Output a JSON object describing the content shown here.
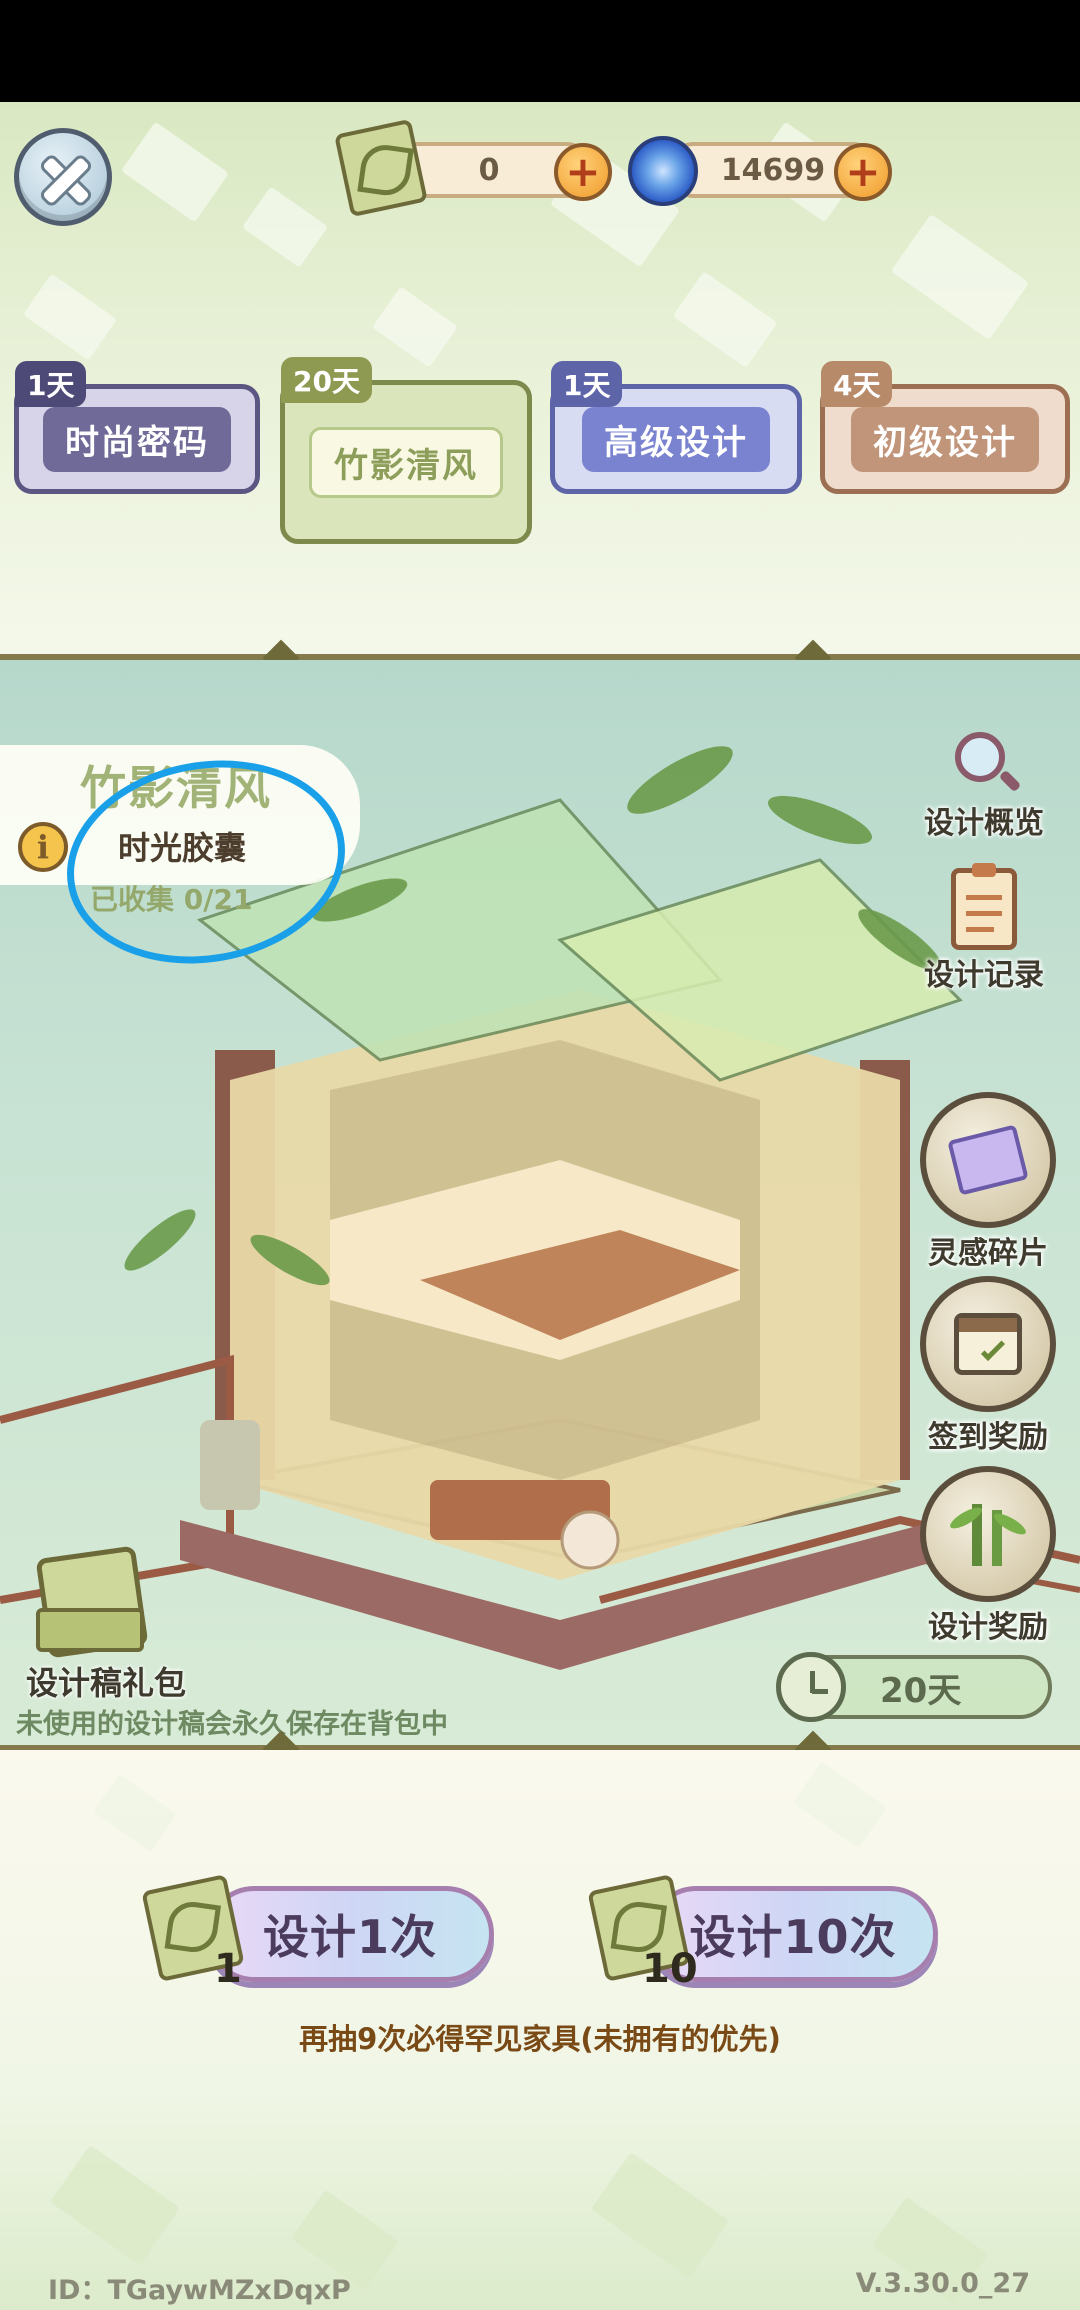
{
  "resources": {
    "draft_count": "0",
    "inspiration_count": "14699"
  },
  "tabs": [
    {
      "badge": "1天",
      "label": "时尚密码"
    },
    {
      "badge": "20天",
      "label": "竹影清风"
    },
    {
      "badge": "1天",
      "label": "高级设计"
    },
    {
      "badge": "4天",
      "label": "初级设计"
    }
  ],
  "banner": {
    "title": "竹影清风",
    "capsule_name": "时光胶囊",
    "collected": "已收集 0/21"
  },
  "side_buttons": {
    "overview": "设计概览",
    "records": "设计记录",
    "fragments": "灵感碎片",
    "signin": "签到奖励",
    "design_reward": "设计奖励"
  },
  "gift": {
    "label": "设计稿礼包",
    "note": "未使用的设计稿会永久保存在背包中"
  },
  "timer": "20天",
  "draw": {
    "single_label": "设计1次",
    "single_cost": "1",
    "ten_label": "设计10次",
    "ten_cost": "10"
  },
  "pity_text": "再抽9次必得罕见家具(未拥有的优先)",
  "footer": {
    "id": "ID：TGaywMZxDqxP",
    "version": "V.3.30.0_27"
  },
  "colors": {
    "tab_fashion": "#5b5682",
    "tab_bamboo": "#b7c98a",
    "tab_advanced": "#7a83cf",
    "tab_basic": "#c0957a",
    "annotation_circle": "#1aa0e8"
  }
}
